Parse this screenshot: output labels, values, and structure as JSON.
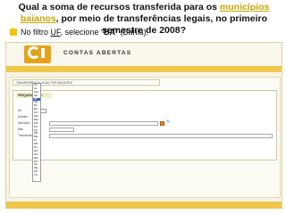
{
  "question": {
    "before": "Qual a soma de recursos transferida para os ",
    "highlight": "municípios baianos",
    "after": ", por meio de transferências legais, no primeiro semestre de 2008?"
  },
  "instruction": {
    "prefix": "No filtro ",
    "filter": "UF",
    "middle": ", selecione “",
    "value": "BA",
    "suffix": "” (Bahia)."
  },
  "colors": {
    "accent": "#efc74a",
    "highlight": "#c8a400",
    "brand_orange": "#e6a21a",
    "selected": "#2d5fb8"
  },
  "screenshot": {
    "brand": "CONTAS ABERTAS",
    "section_title": "TRANSFERÊNCIA LEGAL POR MUNICÍPIO",
    "filter_title": "PESQUISAR POR:",
    "field_labels": [
      "UF",
      "Detalhe",
      "Município",
      "Mês",
      "Transferência"
    ],
    "uf_selected": "BA",
    "uf_options": [
      "AC",
      "AL",
      "AM",
      "AP",
      "BA",
      "CE",
      "DF",
      "ES",
      "GO",
      "MA",
      "MG",
      "MS",
      "MT",
      "PA",
      "PB",
      "PE",
      "PI",
      "PR",
      "RJ",
      "RN",
      "RO",
      "RR",
      "RS",
      "SC",
      "SE",
      "SP",
      "TO"
    ],
    "search_button": "CONSULTAR"
  }
}
